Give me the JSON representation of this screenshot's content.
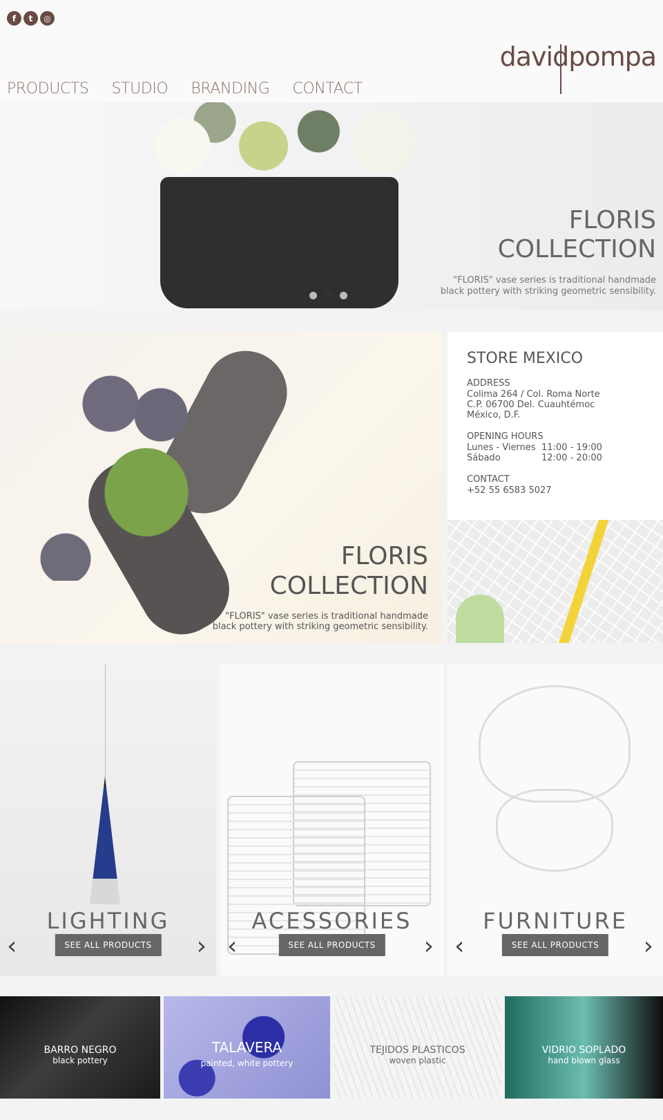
{
  "social": [
    {
      "name": "facebook",
      "glyph": "f"
    },
    {
      "name": "twitter",
      "glyph": "t"
    },
    {
      "name": "instagram",
      "glyph": "◎"
    }
  ],
  "logo": "davidpompa",
  "nav": [
    "PRODUCTS",
    "STUDIO",
    "BRANDING",
    "CONTACT"
  ],
  "hero": {
    "title_line1": "FLORIS",
    "title_line2": "COLLECTION",
    "desc_line1": "\"FLORIS\" vase series is traditional handmade",
    "desc_line2": "black pottery with striking geometric sensibility.",
    "active_slide": 2,
    "slide_count": 3
  },
  "feature": {
    "title_line1": "FLORIS",
    "title_line2": "COLLECTION",
    "desc_line1": "\"FLORIS\" vase series is traditional handmade",
    "desc_line2": "black pottery with striking geometric sensibility."
  },
  "store": {
    "title": "STORE MEXICO",
    "address_label": "ADDRESS",
    "address1": "Colima 264 / Col. Roma Norte",
    "address2": "C.P. 06700 Del. Cuauhtémoc",
    "address3": "México, D.F.",
    "hours_label": "OPENING HOURS",
    "hours": [
      {
        "days": "Lunes - Viernes",
        "time": "11:00 - 19:00"
      },
      {
        "days": "Sábado",
        "time": "12:00 - 20:00"
      }
    ],
    "contact_label": "CONTACT",
    "phone": "+52 55 6583 5027"
  },
  "categories": [
    {
      "title": "LIGHTING",
      "button": "SEE ALL PRODUCTS"
    },
    {
      "title": "ACESSORIES",
      "button": "SEE ALL PRODUCTS"
    },
    {
      "title": "FURNITURE",
      "button": "SEE ALL PRODUCTS"
    }
  ],
  "arrows": {
    "prev": "‹",
    "next": "›"
  },
  "tiles": [
    {
      "title": "BARRO NEGRO",
      "subtitle": "black pottery"
    },
    {
      "title": "TALAVERA",
      "subtitle": "painted, white pottery"
    },
    {
      "title": "TEJIDOS PLASTICOS",
      "subtitle": "woven plastic"
    },
    {
      "title": "VIDRIO SOPLADO",
      "subtitle": "hand blown glass"
    }
  ],
  "colors": {
    "brand": "#6a4a44",
    "button": "#666666"
  }
}
